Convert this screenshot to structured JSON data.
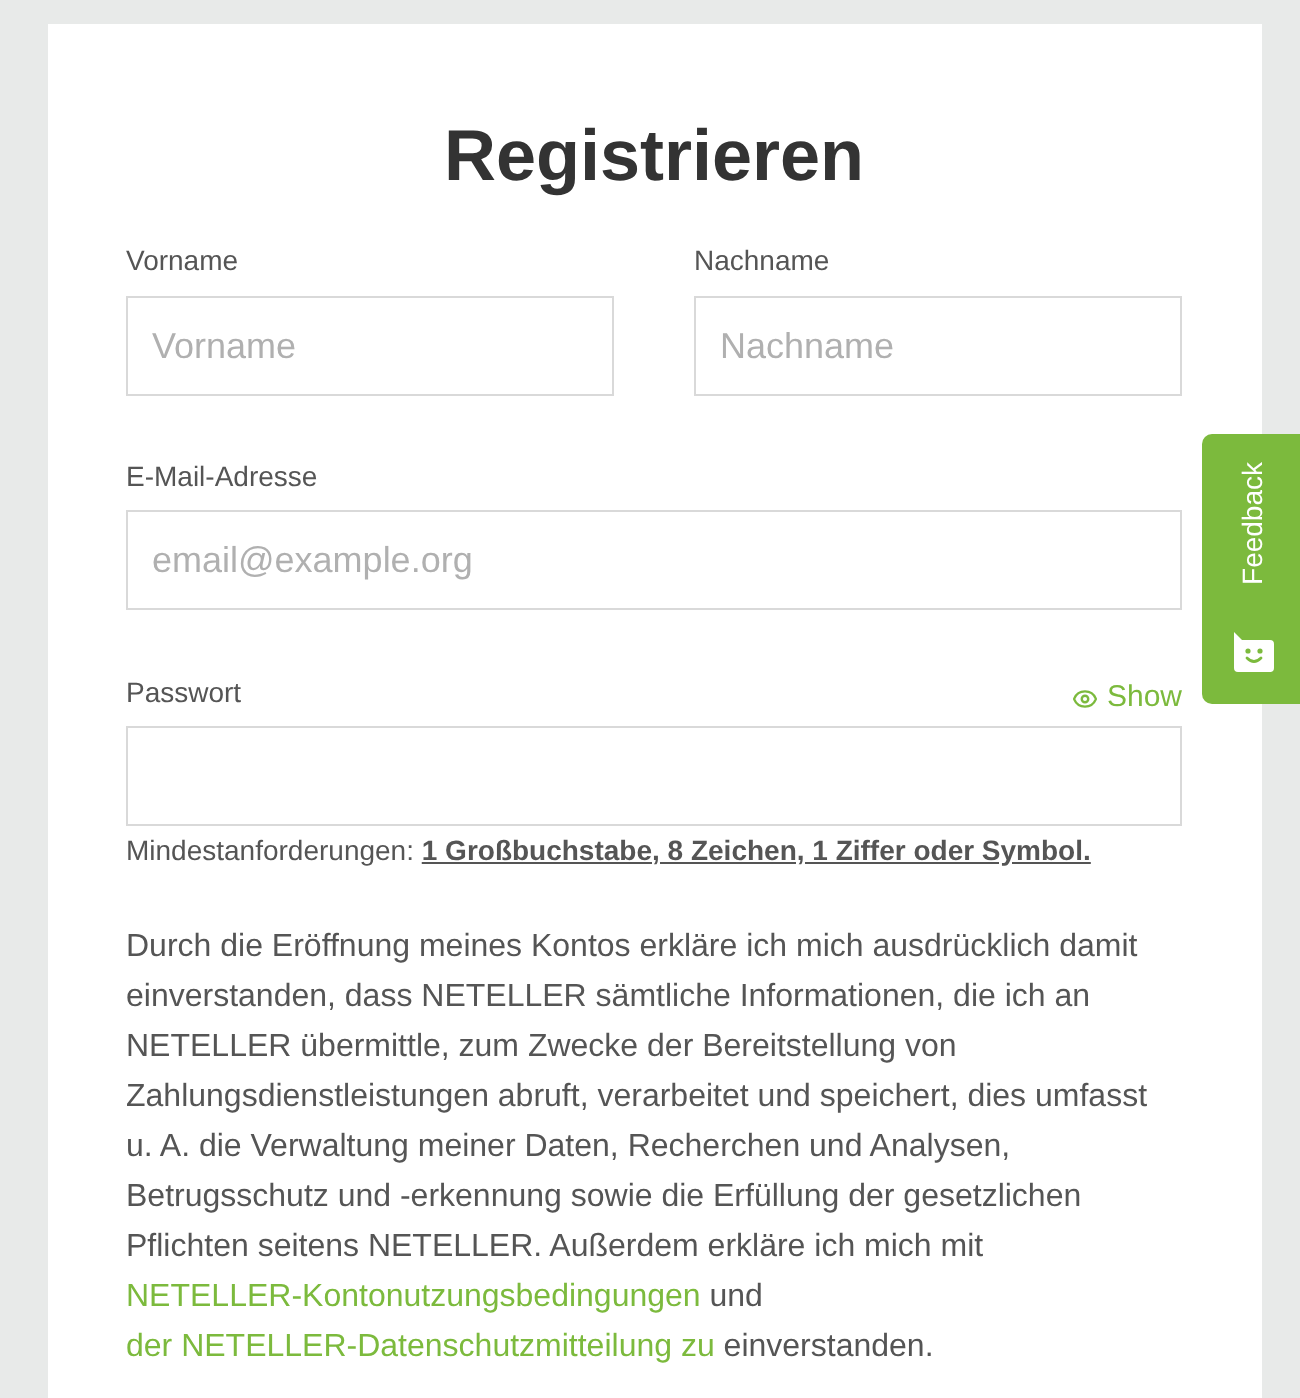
{
  "title": "Registrieren",
  "name_fields": [
    {
      "label": "Vorname",
      "placeholder": "Vorname"
    },
    {
      "label": "Nachname",
      "placeholder": "Nachname"
    }
  ],
  "email_field": {
    "label": "E-Mail-Adresse",
    "placeholder": "email@example.org"
  },
  "password_field": {
    "label": "Passwort",
    "show_link": "Show",
    "hint": "Mindestanforderungen: **1 Großbuchstabe, 8 Zeichen, 1 Ziffer oder Symbol.**"
  },
  "consent": [
    {
      "kind": "text",
      "text": "Durch die Eröffnung meines Kontos erkläre ich mich ausdrücklich damit einverstanden, dass NETELLER sämtliche Informationen, die ich an NETELLER übermittle, zum Zwecke der Bereitstellung von Zahlungsdienstleistungen abruft, verarbeitet und speichert, dies umfasst u. A. die Verwaltung meiner Daten, Recherchen und Analysen, Betrugsschutz und -erkennung sowie die Erfüllung der gesetzlichen Pflichten seitens NETELLER. Außerdem erkläre ich mich mit "
    },
    {
      "kind": "link",
      "text": "NETELLER-Kontonutzungsbedingungen"
    },
    {
      "kind": "text",
      "text": " und "
    },
    {
      "kind": "link",
      "text": "der NETELLER-Datenschutzmitteilung zu"
    },
    {
      "kind": "text",
      "text": " einverstanden."
    }
  ],
  "feedback_tab": {
    "label": "Feedback"
  }
}
